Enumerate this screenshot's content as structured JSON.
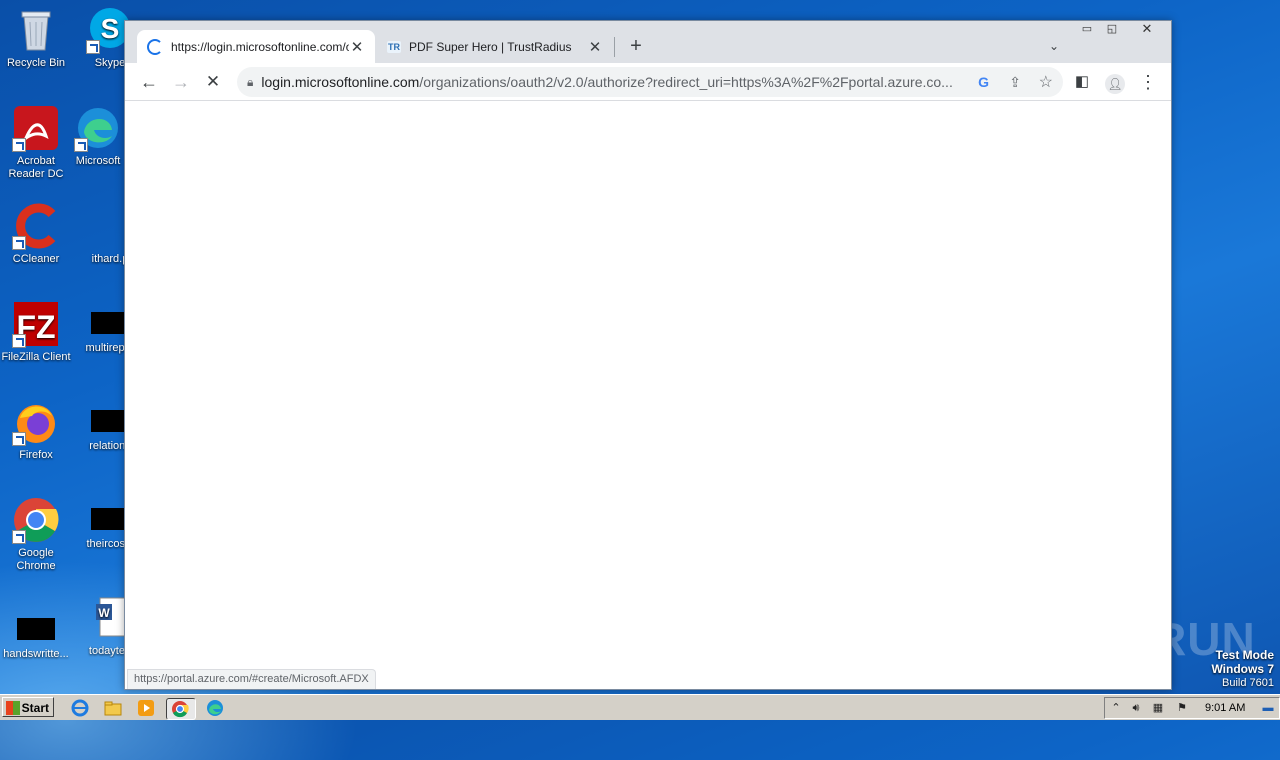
{
  "desktop": {
    "icons": [
      {
        "label": "Recycle Bin"
      },
      {
        "label": "Skype"
      },
      {
        "label": "Acrobat Reader DC"
      },
      {
        "label": "Microsoft"
      },
      {
        "label": "CCleaner"
      },
      {
        "label": "ithard.p"
      },
      {
        "label": "FileZilla Client"
      },
      {
        "label": "multirepor"
      },
      {
        "label": "Firefox"
      },
      {
        "label": "relations"
      },
      {
        "label": "Google Chrome"
      },
      {
        "label": "theircosts"
      },
      {
        "label": "handswritte..."
      },
      {
        "label": "todaytea"
      }
    ],
    "watermark": "ANY RUN",
    "test_mode": {
      "line1": "Test Mode",
      "line2": "Windows 7",
      "line3": "Build 7601"
    }
  },
  "browser": {
    "tabs": [
      {
        "title": "https://login.microsoftonline.com/organizations",
        "active": true
      },
      {
        "title": "PDF Super Hero | TrustRadius",
        "active": false
      }
    ],
    "new_tab": "+",
    "address": {
      "host": "login.microsoftonline.com",
      "path": "/organizations/oauth2/v2.0/authorize?redirect_uri=https%3A%2F%2Fportal.azure.co..."
    },
    "status_url": "https://portal.azure.com/#create/Microsoft.AFDX"
  },
  "taskbar": {
    "start_label": "Start",
    "clock": "9:01 AM"
  }
}
